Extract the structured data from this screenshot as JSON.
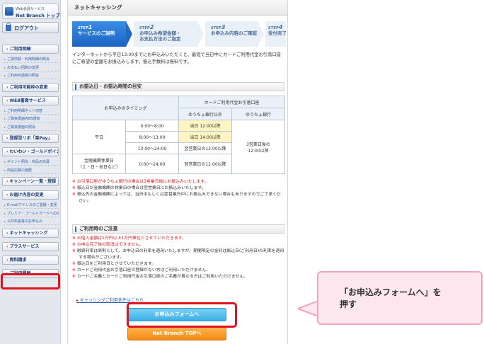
{
  "sidebar": {
    "logo_line1": "Web会員サービス",
    "logo_line2": "Net Branch トップ",
    "logout": "ログアウト",
    "items": [
      {
        "type": "head",
        "label": "ご利用明細"
      },
      {
        "type": "sub",
        "label": "ご請求額・利用明細の照会"
      },
      {
        "type": "sub",
        "label": "お支払い回数の変更"
      },
      {
        "type": "sub",
        "label": "ご利用可能額の照会"
      },
      {
        "type": "head",
        "label": "ご利用可能枠の変更"
      },
      {
        "type": "head",
        "label": "WEB書面サービス"
      },
      {
        "type": "sub",
        "label": "ご利用明細ネット切替"
      },
      {
        "type": "sub",
        "label": "ご融資書面WEB通知"
      },
      {
        "type": "sub",
        "label": "ご融資書面の照会"
      },
      {
        "type": "head",
        "label": "登録型リボ「楽Pay」"
      },
      {
        "type": "head",
        "label": "わいわい・ゴールドポイント"
      },
      {
        "type": "sub",
        "label": "ポイント照会・商品の応募"
      },
      {
        "type": "sub",
        "label": "商品応募の履歴"
      },
      {
        "type": "head",
        "label": "キャンペーン一覧・登録"
      },
      {
        "type": "head",
        "label": "お届け内容の変更"
      },
      {
        "type": "sub",
        "label": "E-mailアドレスのご登録・変更"
      },
      {
        "type": "sub",
        "label": "プレミア・ゴールドカードへの切替"
      },
      {
        "type": "sub",
        "label": "公共料金等のお申込み"
      },
      {
        "type": "head",
        "label": "ネットキャッシング"
      },
      {
        "type": "head",
        "label": "プラスサービス"
      },
      {
        "type": "head",
        "label": "資料請求"
      },
      {
        "type": "head",
        "label": "ご利用履歴"
      }
    ]
  },
  "main": {
    "page_title": "ネットキャッシング",
    "steps": [
      {
        "num": "STEP",
        "n": "1",
        "label1": "サービスのご説明",
        "label2": ""
      },
      {
        "num": "STEP",
        "n": "2",
        "label1": "お申込み希望金額・",
        "label2": "お支払方法のご指定"
      },
      {
        "num": "STEP",
        "n": "3",
        "label1": "お申込み内容のご確認",
        "label2": ""
      },
      {
        "num": "STEP",
        "n": "4",
        "label1": "受付完了",
        "label2": ""
      }
    ],
    "intro": "インターネットから平日13:00までにお申込みいただくと、最短で当日中にカードご利用代金お引落口座にご希望の金額をお振込みします。振込手数料は無料です。",
    "section1_title": "お振込日・お振込時間の目安",
    "table": {
      "h_timing": "お申込みのタイミング",
      "h_account": "カードご利用代金お引落口座",
      "h_other": "ゆうちょ銀行以外",
      "h_yucho": "ゆうちょ銀行",
      "weekday": "平日",
      "holiday": "金融機関休業日\n（土・日・祝日など）",
      "r1_time": "0:00〜8:00",
      "r1_val": "当日 12:00以降",
      "r2_time": "8:00〜13:00",
      "r2_val": "当日 14:00以降",
      "r3_time": "13:00〜24:00",
      "r3_val": "翌営業日の12:00以降",
      "r4_time": "0:00〜24:00",
      "r4_val": "翌営業日の12:00以降",
      "yucho_val": "3営業日後の\n12:00以降"
    },
    "notes1": [
      {
        "mark": "※",
        "text": "お引落口座がゆうちょ銀行の場合は3営業日後にお振込みいたします。",
        "red": true
      },
      {
        "mark": "※",
        "text": "振込日が金融機関の休業日の場合は翌営業日にお振込みいたします。",
        "red": false
      },
      {
        "mark": "※",
        "text": "振込先の金融機関によっては、当日中もしくは翌営業日中にお振込みできない場合もありますのでご了承ください。",
        "red": false
      }
    ],
    "section2_title": "ご利用時のご注意",
    "notes2": [
      {
        "mark": "※",
        "text": "お借入金額は1万円以上1万円単位とさせていただきます。",
        "red": true
      },
      {
        "mark": "※",
        "text": "お申込完了後の取消はできません。",
        "red": true
      },
      {
        "mark": "※",
        "text": "融資利率は原則として、お申込日の利率を適用いたしますが、期間限定の金利は振込日(ご利用日)の利率を適用する場合がございます。",
        "red": false
      },
      {
        "mark": "※",
        "text": "振込日をご利用日とさせていただきます。",
        "red": false
      },
      {
        "mark": "※",
        "text": "カードご利用代金お引落口座の登録がない方はご利用いただけません。",
        "red": false
      },
      {
        "mark": "※",
        "text": "カードご名義とカードご利用代金お引落口座のご名義が異なる方はご利用いただけません。",
        "red": false
      }
    ],
    "link": "キャッシングご利用条件はこちら",
    "btn_form": "お申込みフォームへ",
    "btn_top": "Net Branch TOPへ"
  },
  "callout": {
    "line1": "「お申込みフォームへ」を",
    "line2": "押す"
  },
  "colors": {
    "accent": "#1b63c1",
    "highlight": "#e0141d",
    "callout_bg": "#fde7ee"
  }
}
